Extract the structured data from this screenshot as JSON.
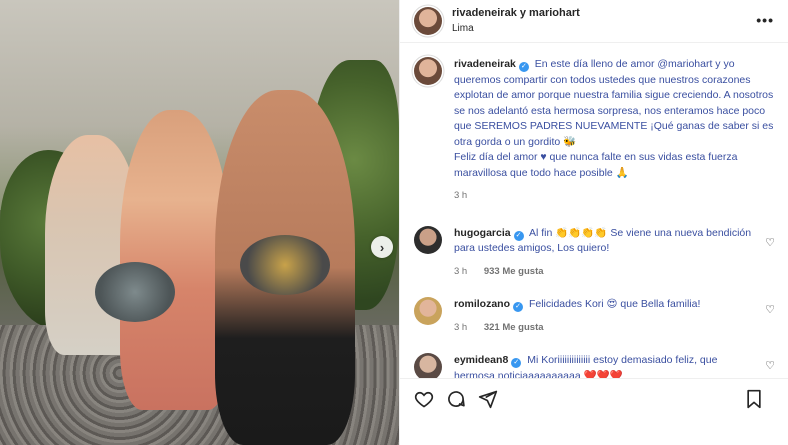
{
  "post": {
    "author_line": "rivadeneirak y mariohart",
    "location": "Lima",
    "more_label": "•••"
  },
  "caption": {
    "username": "rivadeneirak",
    "text": "En este día lleno de amor @mariohart y yo queremos compartir con todos ustedes que nuestros corazones explotan de amor porque nuestra familia sigue creciendo. A nosotros se nos adelantó esta hermosa sorpresa, nos enteramos hace poco que SEREMOS PADRES NUEVAMENTE ¡Qué ganas de saber si es otra gorda o un gordito 🐝",
    "text2": "Feliz día del amor ♥ que nunca falte en sus vidas esta fuerza maravillosa que todo hace posible 🙏",
    "time": "3 h"
  },
  "comments": [
    {
      "username": "hugogarcia",
      "text": "Al fin 👏👏👏👏 Se viene una nueva bendición para ustedes amigos, Los quiero!",
      "time": "3 h",
      "likes": "933 Me gusta"
    },
    {
      "username": "romilozano",
      "text": "Felicidades Kori 😍 que Bella familia!",
      "time": "3 h",
      "likes": "321 Me gusta"
    },
    {
      "username": "eymidean8",
      "text": "Mi Koriiiiiiiiiiiiii estoy demasiado feliz, que hermosa noticiaaaaaaaaaa ❤️❤️❤️",
      "time": "",
      "likes": ""
    }
  ],
  "icons": {
    "next": "chevron-right-icon",
    "like": "heart-icon",
    "comment": "comment-icon",
    "share": "share-icon",
    "save": "bookmark-icon"
  },
  "colors": {
    "verified": "#3897f0",
    "text": "#262626",
    "muted": "#737373",
    "link": "#3a4fa0"
  }
}
